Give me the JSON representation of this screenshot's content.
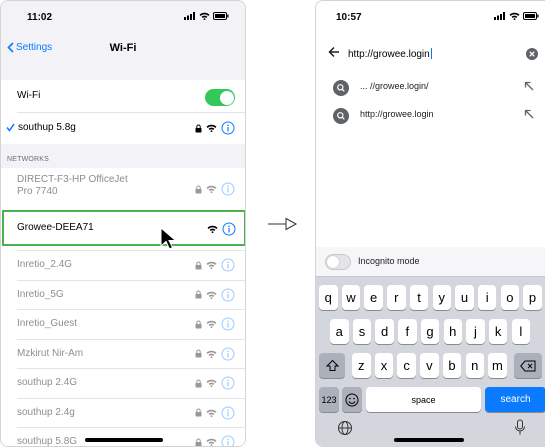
{
  "left_phone": {
    "status_time": "11:02",
    "back_label": "Settings",
    "title": "Wi-Fi",
    "wifi_label": "Wi-Fi",
    "connected_network": "southup 5.8g",
    "section_header": "NETWORKS",
    "networks": [
      {
        "line1": "DIRECT-F3-HP OfficeJet",
        "line2": "Pro 7740"
      },
      {
        "line1": "Growee-DEEA71"
      },
      {
        "line1": "Inretio_2.4G"
      },
      {
        "line1": "Inretio_5G"
      },
      {
        "line1": "Inretio_Guest"
      },
      {
        "line1": "Mzkirut Nir-Am"
      },
      {
        "line1": "southup 2.4G"
      },
      {
        "line1": "southup 2.4g"
      },
      {
        "line1": "southup 5.8G"
      }
    ]
  },
  "right_phone": {
    "status_time": "10:57",
    "url": "http://growee.login",
    "suggestions": [
      "... //growee.login/",
      "http://growee.login"
    ],
    "incognito_label": "Incognito mode",
    "keyboard": {
      "row1": [
        "q",
        "w",
        "e",
        "r",
        "t",
        "y",
        "u",
        "i",
        "o",
        "p"
      ],
      "row2": [
        "a",
        "s",
        "d",
        "f",
        "g",
        "h",
        "j",
        "k",
        "l"
      ],
      "row3": [
        "z",
        "x",
        "c",
        "v",
        "b",
        "n",
        "m"
      ],
      "numbers_key": "123",
      "space_key": "space",
      "search_key": "search"
    }
  },
  "colors": {
    "ios_blue": "#0a7aff",
    "toggle_green": "#34c759",
    "highlight_green": "#4caf50"
  }
}
